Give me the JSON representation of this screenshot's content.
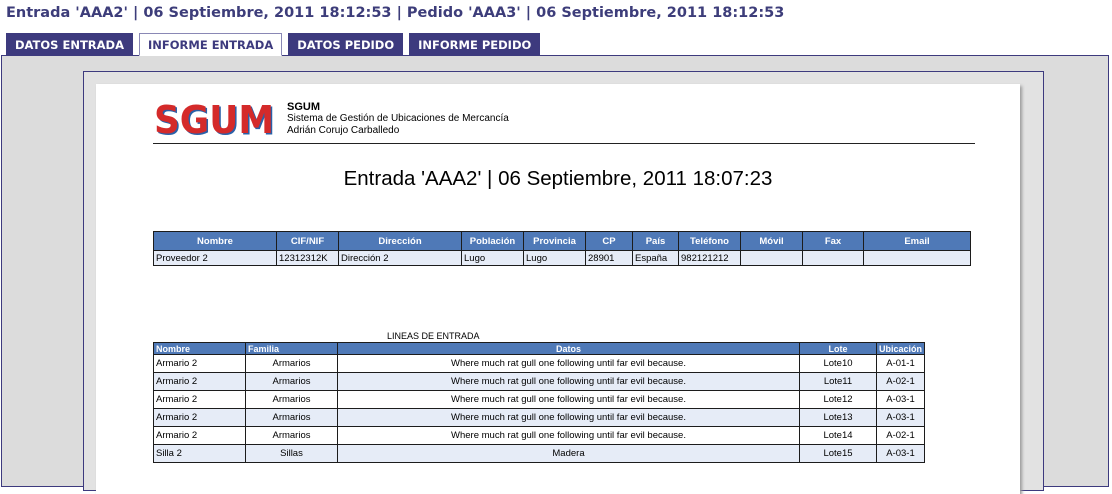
{
  "header": {
    "title": "Entrada 'AAA2' | 06 Septiembre, 2011 18:12:53 | Pedido 'AAA3' | 06 Septiembre, 2011 18:12:53"
  },
  "tabs": [
    {
      "label": "DATOS ENTRADA",
      "active": false
    },
    {
      "label": "INFORME ENTRADA",
      "active": true
    },
    {
      "label": "DATOS PEDIDO",
      "active": false
    },
    {
      "label": "INFORME PEDIDO",
      "active": false
    }
  ],
  "report": {
    "logo_text": "SGUM",
    "org_name": "SGUM",
    "org_subtitle": "Sistema de Gestión de Ubicaciones de Mercancía",
    "org_author": "Adrián Corujo Carballedo",
    "doc_title": "Entrada 'AAA2' | 06 Septiembre, 2011 18:07:23",
    "provider_table": {
      "headers": [
        "Nombre",
        "CIF/NIF",
        "Dirección",
        "Población",
        "Provincia",
        "CP",
        "País",
        "Teléfono",
        "Móvil",
        "Fax",
        "Email"
      ],
      "rows": [
        [
          "Proveedor 2",
          "12312312K",
          "Dirección 2",
          "Lugo",
          "Lugo",
          "28901",
          "España",
          "982121212",
          "",
          "",
          ""
        ]
      ]
    },
    "lines_caption": "LINEAS DE ENTRADA",
    "lines_table": {
      "headers": [
        "Nombre",
        "Familia",
        "Datos",
        "Lote",
        "Ubicación"
      ],
      "rows": [
        [
          "Armario 2",
          "Armarios",
          "Where much rat gull one following until far evil because.",
          "Lote10",
          "A-01-1"
        ],
        [
          "Armario 2",
          "Armarios",
          "Where much rat gull one following until far evil because.",
          "Lote11",
          "A-02-1"
        ],
        [
          "Armario 2",
          "Armarios",
          "Where much rat gull one following until far evil because.",
          "Lote12",
          "A-03-1"
        ],
        [
          "Armario 2",
          "Armarios",
          "Where much rat gull one following until far evil because.",
          "Lote13",
          "A-03-1"
        ],
        [
          "Armario 2",
          "Armarios",
          "Where much rat gull one following until far evil because.",
          "Lote14",
          "A-02-1"
        ],
        [
          "Silla 2",
          "Sillas",
          "Madera",
          "Lote15",
          "A-03-1"
        ]
      ]
    }
  },
  "colors": {
    "accent": "#3d3a7e",
    "table_header": "#4f79b7",
    "row_alt": "#e6ecf7",
    "logo_red": "#d42a2a",
    "logo_blue": "#2a60a8"
  }
}
